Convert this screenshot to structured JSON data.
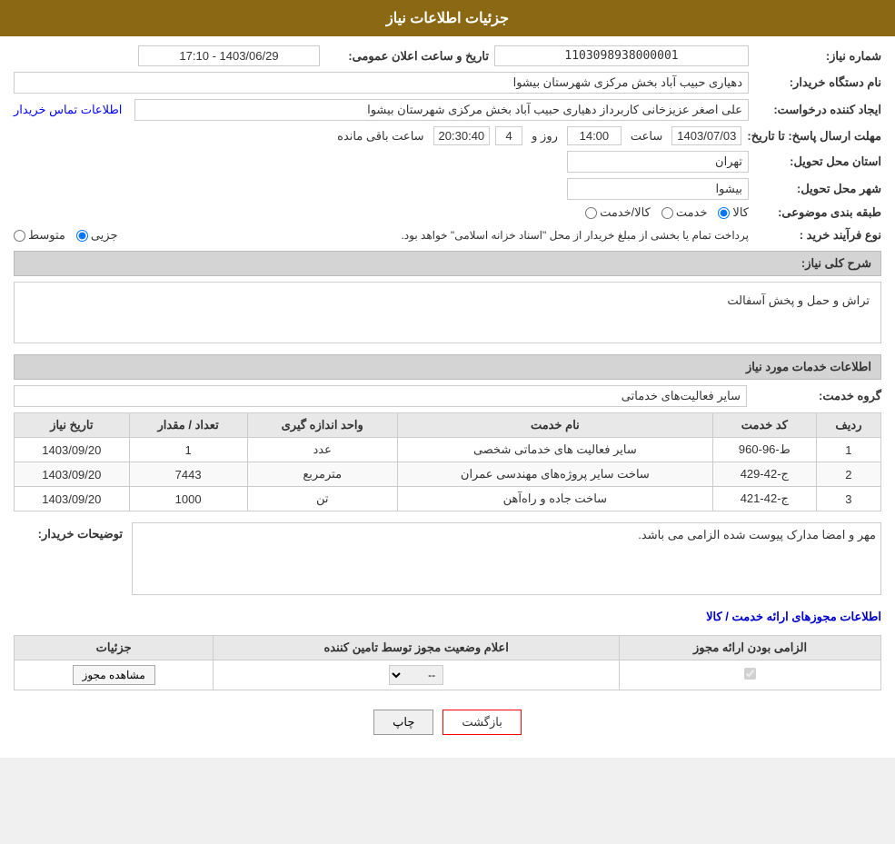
{
  "page": {
    "title": "جزئیات اطلاعات نیاز"
  },
  "fields": {
    "need_number_label": "شماره نیاز:",
    "need_number_value": "1103098938000001",
    "buyer_system_label": "نام دستگاه خریدار:",
    "buyer_system_value": "دهیاری حبیب آباد بخش مرکزی شهرستان بیشوا",
    "date_announce_label": "تاریخ و ساعت اعلان عمومی:",
    "date_announce_value": "1403/06/29 - 17:10",
    "creator_label": "ایجاد کننده درخواست:",
    "creator_value": "علی اصغر عزیزخانی کاربرداز دهیاری حبیب آباد بخش مرکزی شهرستان بیشوا",
    "contact_link": "اطلاعات تماس خریدار",
    "response_deadline_label": "مهلت ارسال پاسخ: تا تاریخ:",
    "response_date": "1403/07/03",
    "response_time_label": "ساعت",
    "response_time": "14:00",
    "response_days_label": "روز و",
    "response_days": "4",
    "response_remaining_label": "ساعت باقی مانده",
    "response_remaining": "20:30:40",
    "province_label": "استان محل تحویل:",
    "province_value": "تهران",
    "city_label": "شهر محل تحویل:",
    "city_value": "بیشوا",
    "category_label": "طبقه بندی موضوعی:",
    "category_radio1": "کالا",
    "category_radio2": "خدمت",
    "category_radio3": "کالا/خدمت",
    "purchase_type_label": "نوع فرآیند خرید :",
    "purchase_notice": "پرداخت تمام یا بخشی از مبلغ خریدار از محل \"اسناد خزانه اسلامی\" خواهد بود.",
    "purchase_radio1": "جزیی",
    "purchase_radio2": "متوسط",
    "need_description_label": "شرح کلی نیاز:",
    "need_description_value": "تراش و حمل و پخش آسفالت",
    "services_section_title": "اطلاعات خدمات مورد نیاز",
    "service_group_label": "گروه خدمت:",
    "service_group_value": "سایر فعالیت‌های خدماتی",
    "table_headers": [
      "ردیف",
      "کد خدمت",
      "نام خدمت",
      "واحد اندازه گیری",
      "تعداد / مقدار",
      "تاریخ نیاز"
    ],
    "table_rows": [
      {
        "row": "1",
        "code": "ط-96-960",
        "name": "سایر فعالیت های خدماتی شخصی",
        "unit": "عدد",
        "quantity": "1",
        "date": "1403/09/20"
      },
      {
        "row": "2",
        "code": "ج-42-429",
        "name": "ساخت سایر پروژه‌های مهندسی عمران",
        "unit": "مترمربع",
        "quantity": "7443",
        "date": "1403/09/20"
      },
      {
        "row": "3",
        "code": "ج-42-421",
        "name": "ساخت جاده و راه‌آهن",
        "unit": "تن",
        "quantity": "1000",
        "date": "1403/09/20"
      }
    ],
    "buyer_notes_label": "توضیحات خریدار:",
    "buyer_notes_value": "مهر و امضا مدارک پیوست شده الزامی می باشد.",
    "licenses_section_title": "اطلاعات مجوزهای ارائه خدمت / کالا",
    "licenses_table_headers": [
      "الزامی بودن ارائه مجوز",
      "اعلام وضعیت مجوز توسط تامین کننده",
      "جزئیات"
    ],
    "licenses_table_rows": [
      {
        "required": true,
        "status": "--",
        "details_btn": "مشاهده مجوز"
      }
    ],
    "btn_back": "بازگشت",
    "btn_print": "چاپ"
  }
}
